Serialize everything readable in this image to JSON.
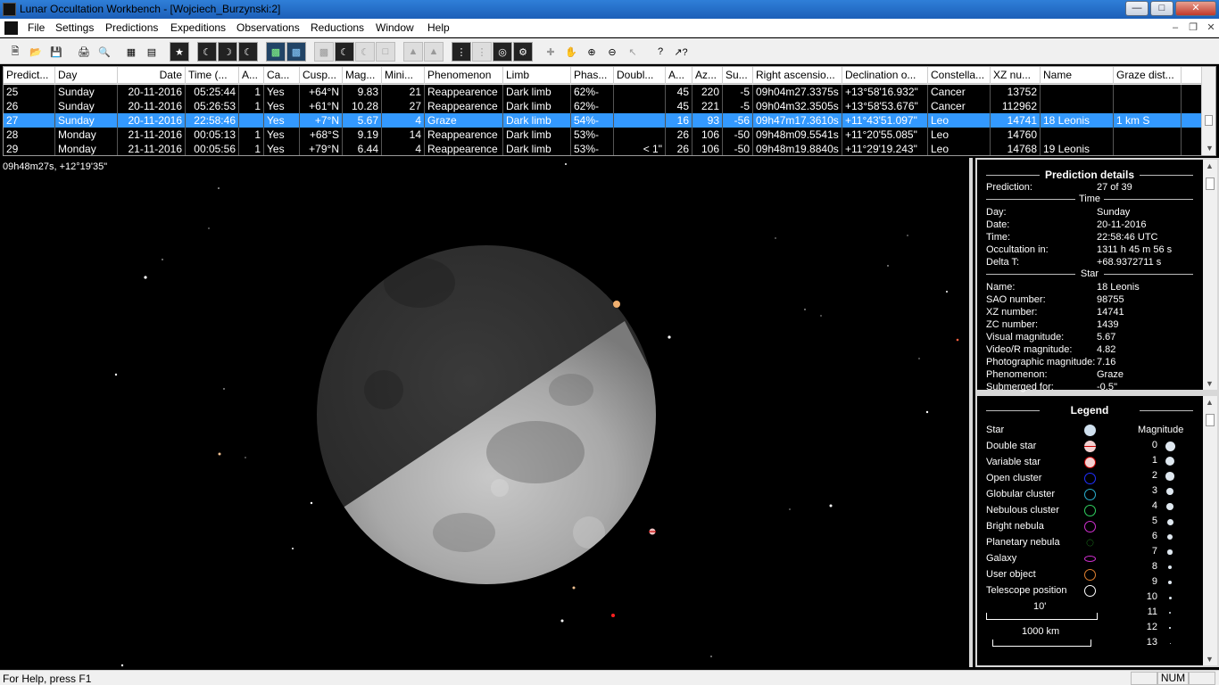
{
  "window": {
    "title": "Lunar Occultation Workbench - [Wojciech_Burzynski:2]"
  },
  "menu": [
    "File",
    "Settings",
    "Predictions",
    "Expeditions",
    "Observations",
    "Reductions",
    "Window",
    "Help"
  ],
  "table": {
    "headers": [
      "Predict...",
      "Day",
      "Date",
      "Time (...",
      "A...",
      "Ca...",
      "Cusp...",
      "Mag...",
      "Mini...",
      "Phenomenon",
      "Limb",
      "Phas...",
      "Doubl...",
      "A...",
      "Az...",
      "Su...",
      "Right ascensio...",
      "Declination o...",
      "Constella...",
      "XZ nu...",
      "Name",
      "Graze dist..."
    ],
    "rows": [
      [
        "25",
        "Sunday",
        "20-11-2016",
        "05:25:44",
        "1",
        "Yes",
        "+64°N",
        "9.83",
        "21",
        "Reappearence",
        "Dark limb",
        "62%-",
        "",
        "45",
        "220",
        "-5",
        "09h04m27.3375s",
        "+13°58'16.932\"",
        "Cancer",
        "13752",
        "",
        ""
      ],
      [
        "26",
        "Sunday",
        "20-11-2016",
        "05:26:53",
        "1",
        "Yes",
        "+61°N",
        "10.28",
        "27",
        "Reappearence",
        "Dark limb",
        "62%-",
        "",
        "45",
        "221",
        "-5",
        "09h04m32.3505s",
        "+13°58'53.676\"",
        "Cancer",
        "112962",
        "",
        ""
      ],
      [
        "27",
        "Sunday",
        "20-11-2016",
        "22:58:46",
        "",
        "Yes",
        "+7°N",
        "5.67",
        "4",
        "Graze",
        "Dark limb",
        "54%-",
        "",
        "16",
        "93",
        "-56",
        "09h47m17.3610s",
        "+11°43'51.097\"",
        "Leo",
        "14741",
        "18 Leonis",
        "1 km S"
      ],
      [
        "28",
        "Monday",
        "21-11-2016",
        "00:05:13",
        "1",
        "Yes",
        "+68°S",
        "9.19",
        "14",
        "Reappearence",
        "Dark limb",
        "53%-",
        "",
        "26",
        "106",
        "-50",
        "09h48m09.5541s",
        "+11°20'55.085\"",
        "Leo",
        "14760",
        "",
        ""
      ],
      [
        "29",
        "Monday",
        "21-11-2016",
        "00:05:56",
        "1",
        "Yes",
        "+79°N",
        "6.44",
        "4",
        "Reappearence",
        "Dark limb",
        "53%-",
        "< 1\"",
        "26",
        "106",
        "-50",
        "09h48m19.8840s",
        "+11°29'19.243\"",
        "Leo",
        "14768",
        "19 Leonis",
        ""
      ]
    ],
    "selected_row": 2
  },
  "sky": {
    "cursor_coords": "09h48m27s, +12°19'35\""
  },
  "details": {
    "title": "Prediction details",
    "prediction_label": "Prediction:",
    "prediction_value": "27 of 39",
    "time_section": "Time",
    "time_rows": [
      [
        "Day:",
        "Sunday"
      ],
      [
        "Date:",
        "20-11-2016"
      ],
      [
        "Time:",
        "22:58:46 UTC"
      ],
      [
        "Occultation in:",
        "1311 h  45 m  56 s"
      ],
      [
        "Delta T:",
        "+68.9372711 s"
      ]
    ],
    "star_section": "Star",
    "star_rows": [
      [
        "Name:",
        "18 Leonis"
      ],
      [
        "SAO number:",
        "98755"
      ],
      [
        "XZ number:",
        "14741"
      ],
      [
        "ZC number:",
        "1439"
      ],
      [
        "Visual magnitude:",
        "5.67"
      ],
      [
        "Video/R magnitude:",
        "4.82"
      ],
      [
        "Photographic magnitude:",
        "7.16"
      ],
      [
        "Phenomenon:",
        "Graze"
      ],
      [
        "Submerged for:",
        "-0.5''"
      ]
    ]
  },
  "legend": {
    "title": "Legend",
    "mag_header": "Magnitude",
    "items": [
      "Star",
      "Double star",
      "Variable star",
      "Open cluster",
      "Globular cluster",
      "Nebulous cluster",
      "Bright nebula",
      "Planetary nebula",
      "Galaxy",
      "User object",
      "Telescope position"
    ],
    "mags": [
      "0",
      "1",
      "2",
      "3",
      "4",
      "5",
      "6",
      "7",
      "8",
      "9",
      "10",
      "11",
      "12",
      "13"
    ],
    "scale_angle": "10'",
    "scale_distance": "1000 km"
  },
  "status": {
    "help": "For Help, press F1",
    "num": "NUM"
  }
}
